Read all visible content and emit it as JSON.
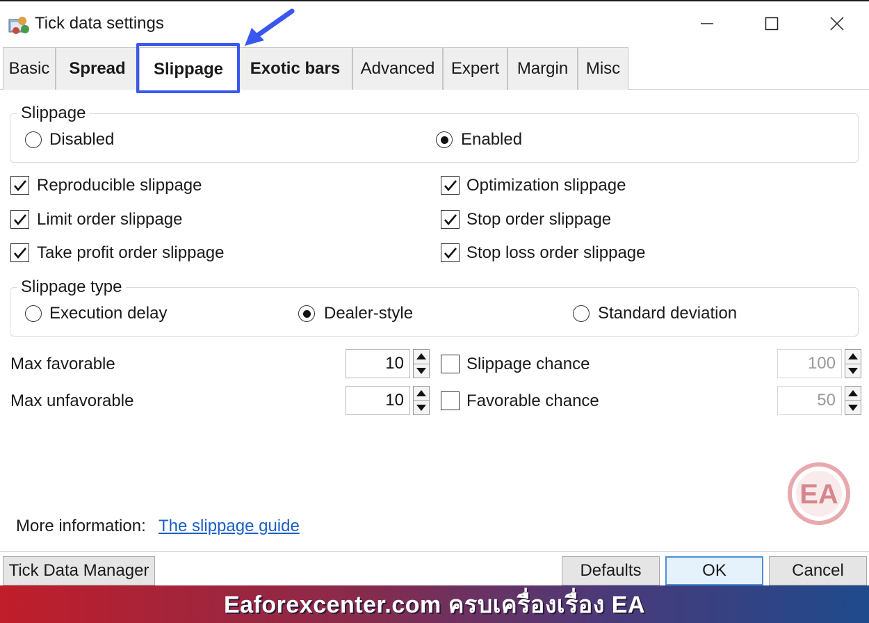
{
  "window": {
    "title": "Tick data settings"
  },
  "tabs": [
    {
      "label": "Basic"
    },
    {
      "label": "Spread"
    },
    {
      "label": "Slippage"
    },
    {
      "label": "Exotic bars"
    },
    {
      "label": "Advanced"
    },
    {
      "label": "Expert"
    },
    {
      "label": "Margin"
    },
    {
      "label": "Misc"
    }
  ],
  "slippage_group": {
    "legend": "Slippage",
    "options": [
      {
        "label": "Disabled",
        "selected": false
      },
      {
        "label": "Enabled",
        "selected": true
      }
    ]
  },
  "checkboxes": [
    {
      "label": "Reproducible slippage",
      "checked": true
    },
    {
      "label": "Optimization slippage",
      "checked": true
    },
    {
      "label": "Limit order slippage",
      "checked": true
    },
    {
      "label": "Stop order slippage",
      "checked": true
    },
    {
      "label": "Take profit order slippage",
      "checked": true
    },
    {
      "label": "Stop loss order slippage",
      "checked": true
    }
  ],
  "slippage_type": {
    "legend": "Slippage type",
    "options": [
      {
        "label": "Execution delay",
        "selected": false
      },
      {
        "label": "Dealer-style",
        "selected": true
      },
      {
        "label": "Standard deviation",
        "selected": false
      }
    ]
  },
  "fields": {
    "max_favorable": {
      "label": "Max favorable",
      "value": "10"
    },
    "max_unfavorable": {
      "label": "Max unfavorable",
      "value": "10"
    },
    "slippage_chance": {
      "label": "Slippage chance",
      "checked": false,
      "value": "100"
    },
    "favorable_chance": {
      "label": "Favorable chance",
      "checked": false,
      "value": "50"
    }
  },
  "more_info": {
    "label": "More information:",
    "link": "The slippage guide"
  },
  "footer": {
    "tick_data_manager": "Tick Data Manager",
    "defaults": "Defaults",
    "ok": "OK",
    "cancel": "Cancel"
  },
  "watermark": {
    "text": "EA"
  },
  "banner": {
    "text": "Eaforexcenter.com ครบเครื่องเรื่อง EA"
  },
  "colors": {
    "highlight": "#3957ee",
    "link": "#1a5fc4",
    "banner_start": "#c01e2a",
    "banner_end": "#1f4a8c"
  }
}
